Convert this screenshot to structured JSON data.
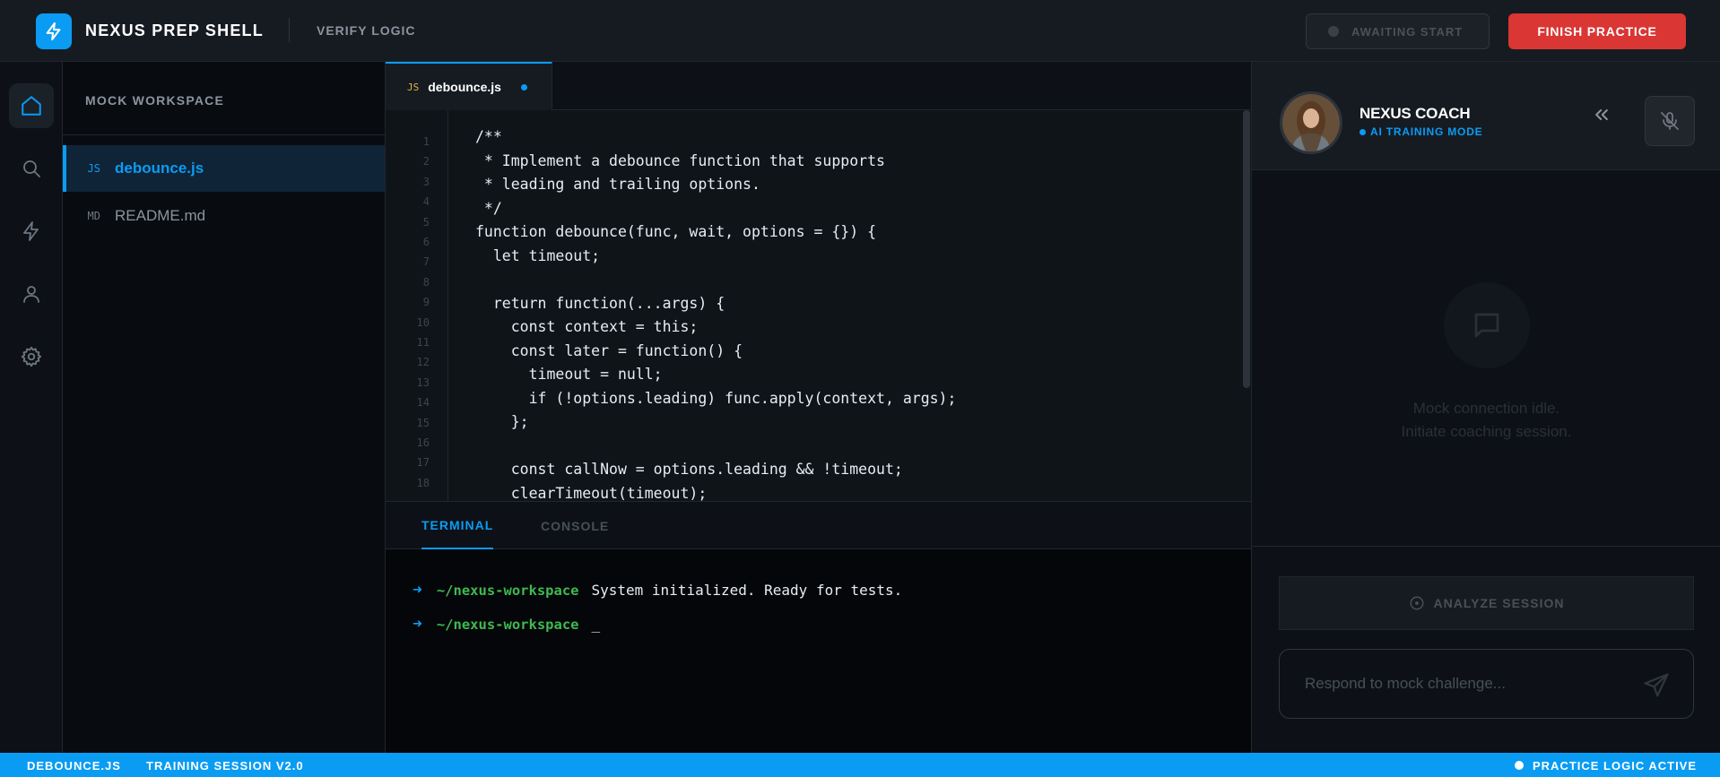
{
  "header": {
    "brand": "NEXUS PREP SHELL",
    "mode": "VERIFY LOGIC",
    "status_label": "AWAITING START",
    "finish_label": "FINISH PRACTICE",
    "logo_icon": "lightning-bolt-icon"
  },
  "rail": {
    "items": [
      {
        "name": "home",
        "icon": "home-icon",
        "active": true
      },
      {
        "name": "search",
        "icon": "search-icon",
        "active": false
      },
      {
        "name": "actions",
        "icon": "lightning-icon",
        "active": false
      },
      {
        "name": "profile",
        "icon": "user-icon",
        "active": false
      },
      {
        "name": "settings",
        "icon": "gear-icon",
        "active": false
      }
    ]
  },
  "explorer": {
    "title": "MOCK WORKSPACE",
    "files": [
      {
        "ext": "JS",
        "name": "debounce.js",
        "active": true
      },
      {
        "ext": "MD",
        "name": "README.md",
        "active": false
      }
    ]
  },
  "editor": {
    "tab": {
      "ext": "JS",
      "name": "debounce.js",
      "modified": true
    },
    "line_numbers": [
      "1",
      "2",
      "3",
      "4",
      "5",
      "6",
      "7",
      "8",
      "9",
      "10",
      "11",
      "12",
      "13",
      "14",
      "15",
      "16",
      "17",
      "18"
    ],
    "code_lines": [
      "/**",
      " * Implement a debounce function that supports",
      " * leading and trailing options.",
      " */",
      "function debounce(func, wait, options = {}) {",
      "  let timeout;",
      "",
      "  return function(...args) {",
      "    const context = this;",
      "    const later = function() {",
      "      timeout = null;",
      "      if (!options.leading) func.apply(context, args);",
      "    };",
      "",
      "    const callNow = options.leading && !timeout;",
      "    clearTimeout(timeout);"
    ]
  },
  "terminal": {
    "tabs": [
      "TERMINAL",
      "CONSOLE"
    ],
    "active_tab": "TERMINAL",
    "lines": [
      {
        "path": "~/nexus-workspace",
        "text": "System initialized. Ready for tests."
      },
      {
        "path": "~/nexus-workspace",
        "text": "_"
      }
    ]
  },
  "coach": {
    "name": "NEXUS COACH",
    "mode": "AI TRAINING MODE",
    "idle_line1": "Mock connection idle.",
    "idle_line2": "Initiate coaching session.",
    "analyze_label": "ANALYZE SESSION",
    "input_placeholder": "Respond to mock challenge...",
    "input_value": ""
  },
  "statusbar": {
    "file": "DEBOUNCE.JS",
    "session": "TRAINING SESSION V2.0",
    "state": "PRACTICE LOGIC ACTIVE"
  },
  "colors": {
    "accent": "#0a9cf3",
    "danger": "#da3633",
    "terminal_path": "#3fb950",
    "js_badge": "#e3b341"
  }
}
